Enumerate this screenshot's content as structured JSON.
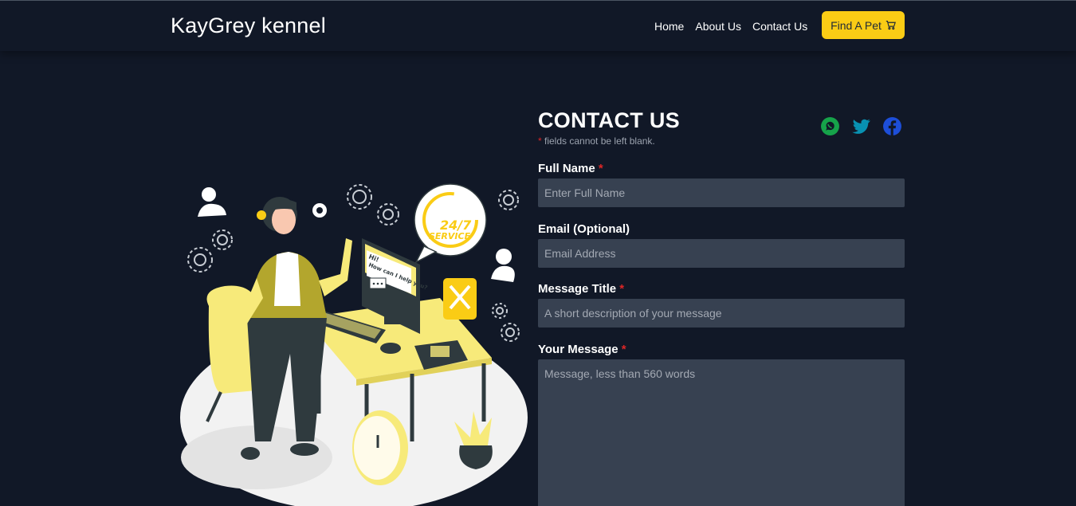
{
  "nav": {
    "brand": "KayGrey kennel",
    "links": [
      "Home",
      "About Us",
      "Contact Us"
    ],
    "cta_label": "Find A Pet",
    "cta_icon": "cart-icon"
  },
  "contact": {
    "title": "CONTACT US",
    "required_mark": "*",
    "note": " fields cannot be left blank.",
    "socials": [
      "whatsapp-icon",
      "twitter-icon",
      "facebook-icon"
    ]
  },
  "form": {
    "full_name": {
      "label": "Full Name",
      "placeholder": "Enter Full Name",
      "required": "*"
    },
    "email": {
      "label": "Email (Optional)",
      "placeholder": "Email Address"
    },
    "message_title": {
      "label": "Message Title",
      "placeholder": "A short description of your message",
      "required": "*"
    },
    "message": {
      "label": "Your Message",
      "placeholder": "Message, less than 560 words",
      "required": "*"
    }
  },
  "illustration": {
    "bubble_text": "24/7",
    "bubble_sub": "SERVICE",
    "screen_line1": "Hi!",
    "screen_line2": "How can I help you?"
  },
  "colors": {
    "background": "#111827",
    "accent": "#facc15",
    "input": "#374151",
    "required": "#dc2626",
    "whatsapp": "#16a34a",
    "twitter": "#0891b2",
    "facebook": "#1d4ed8"
  }
}
